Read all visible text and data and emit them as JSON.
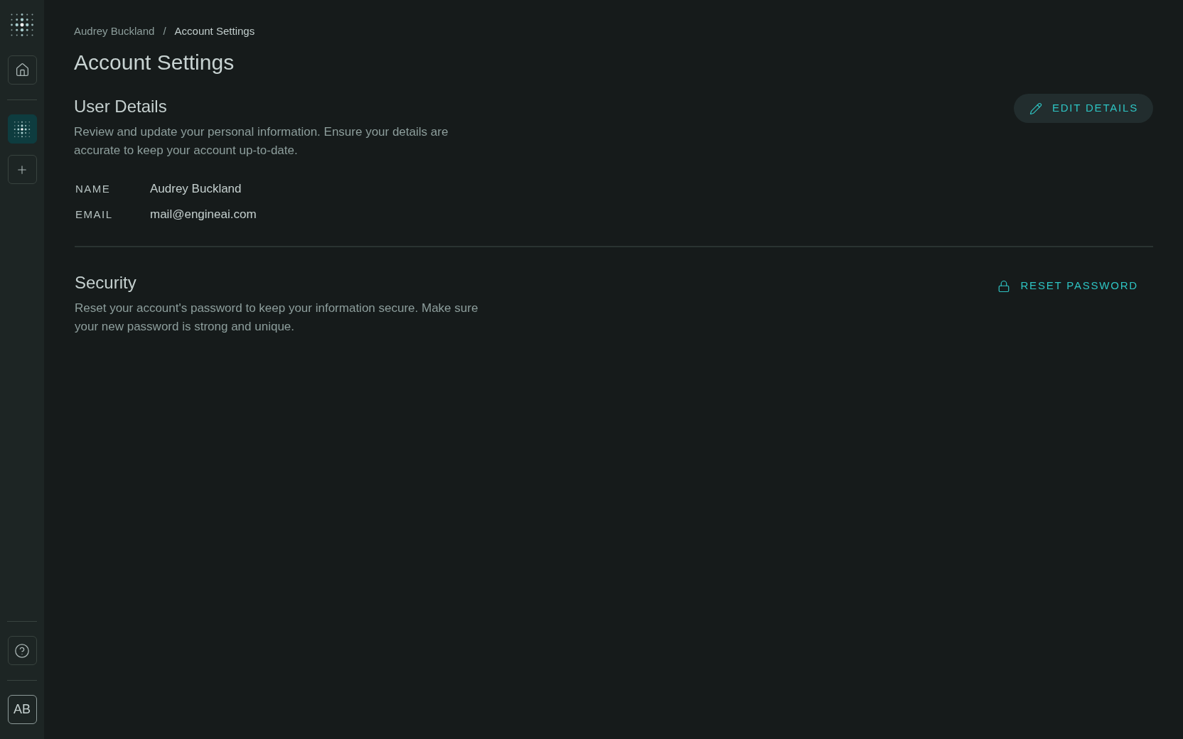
{
  "sidebar": {
    "nav_items": [
      {
        "kind": "home",
        "selected": false
      },
      {
        "kind": "workspace",
        "selected": true
      },
      {
        "kind": "add",
        "selected": false
      }
    ],
    "avatar": {
      "initials": "AB"
    }
  },
  "breadcrumb": {
    "items": [
      "Audrey Buckland",
      "Account Settings"
    ],
    "separator": "/"
  },
  "page_title": "Account Settings",
  "sections": [
    {
      "title": "User Details",
      "description": "Review and update your personal information. Ensure your details are accurate to keep your account up-to-date.",
      "action": {
        "label": "EDIT DETAILS",
        "kind": "edit"
      },
      "fields": [
        {
          "label": "NAME",
          "value": "Audrey Buckland"
        },
        {
          "label": "EMAIL",
          "value": "mail@engineai.com"
        }
      ]
    },
    {
      "title": "Security",
      "description": "Reset your account's password to keep your information secure. Make sure your new password is strong and unique.",
      "action": {
        "label": "RESET PASSWORD",
        "kind": "lock"
      }
    }
  ]
}
